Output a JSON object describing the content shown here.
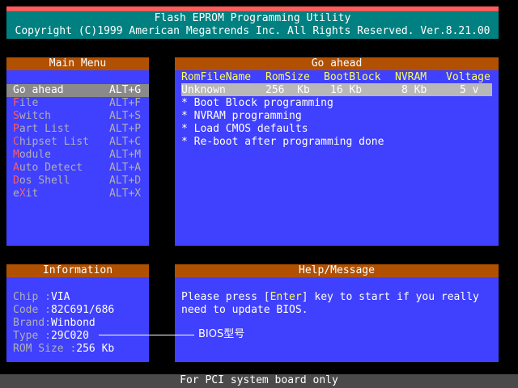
{
  "title": {
    "line1": "Flash EPROM Programming Utility",
    "line2": "Copyright (C)1999 American Megatrends Inc. All Rights Reserved. Ver.8.21.00"
  },
  "main_menu": {
    "heading": "Main Menu",
    "items": [
      {
        "hot": "G",
        "rest": "o ahead",
        "key": "ALT+G",
        "selected": true
      },
      {
        "hot": "F",
        "rest": "ile",
        "key": "ALT+F"
      },
      {
        "hot": "S",
        "rest": "witch",
        "key": "ALT+S"
      },
      {
        "hot": "P",
        "rest": "art List",
        "key": "ALT+P"
      },
      {
        "hot": "C",
        "rest": "hipset List",
        "key": "ALT+C"
      },
      {
        "hot": "M",
        "rest": "odule",
        "key": "ALT+M"
      },
      {
        "hot": "A",
        "rest": "uto Detect",
        "key": "ALT+A"
      },
      {
        "hot": "D",
        "rest": "os Shell",
        "key": "ALT+D"
      },
      {
        "pre": "e",
        "hot": "X",
        "rest": "it",
        "key": "ALT+X"
      }
    ]
  },
  "go_ahead": {
    "heading": "Go ahead",
    "columns": [
      "RomFileName",
      "RomSize",
      "BootBlock",
      "NVRAM",
      "Voltage"
    ],
    "row": {
      "romfile": "Unknown",
      "romsize": "256  Kb",
      "bootblock": "16 Kb",
      "nvram": "8 Kb",
      "voltage": "5 v"
    },
    "steps": [
      "* Boot Block programming",
      "* NVRAM programming",
      "* Load CMOS defaults",
      "* Re-boot after programming done"
    ]
  },
  "information": {
    "heading": "Information",
    "fields": [
      {
        "label": "Chip :",
        "value": "VIA"
      },
      {
        "label": "Code :",
        "value": "82C691/686"
      },
      {
        "label": "Brand:",
        "value": "Winbond"
      },
      {
        "label": "Type :",
        "value": "29C020"
      },
      {
        "label": "ROM Size :",
        "value": "256 Kb"
      }
    ]
  },
  "help": {
    "heading": "Help/Message",
    "line1_pre": "Please press [",
    "line1_key": "Enter",
    "line1_post": "] key to start if you really",
    "line2": "need to update BIOS."
  },
  "annotation": {
    "text": "BIOS型号"
  },
  "bottom_bar": {
    "text": "For PCI system board only"
  }
}
